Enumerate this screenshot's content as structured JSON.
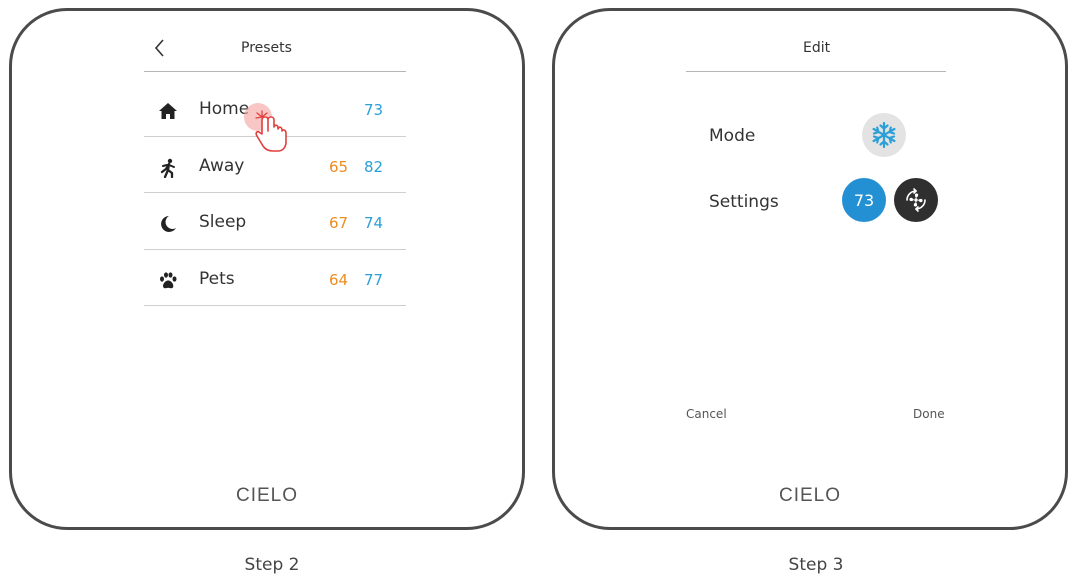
{
  "step2": {
    "caption": "Step 2",
    "screen_title": "Presets",
    "presets": [
      {
        "label": "Home",
        "icon": "home-icon",
        "heat": "",
        "cool": "73"
      },
      {
        "label": "Away",
        "icon": "walk-icon",
        "heat": "65",
        "cool": "82"
      },
      {
        "label": "Sleep",
        "icon": "moon-icon",
        "heat": "67",
        "cool": "74"
      },
      {
        "label": "Pets",
        "icon": "paw-icon",
        "heat": "64",
        "cool": "77"
      }
    ],
    "brand": "CIELO"
  },
  "step3": {
    "caption": "Step 3",
    "screen_title": "Edit",
    "mode_label": "Mode",
    "mode_icon": "snowflake-icon",
    "settings_label": "Settings",
    "temperature": "73",
    "fan_icon": "fan-icon",
    "cancel_label": "Cancel",
    "done_label": "Done",
    "brand": "CIELO"
  },
  "colors": {
    "heat": "#ee8c1f",
    "cool": "#2a9fd8",
    "frame": "#4b4b4b",
    "temp_badge": "#2290d2",
    "fan_badge": "#2f2f2f",
    "mode_badge": "#e3e3e3",
    "tap_highlight": "#f6a7a7"
  }
}
